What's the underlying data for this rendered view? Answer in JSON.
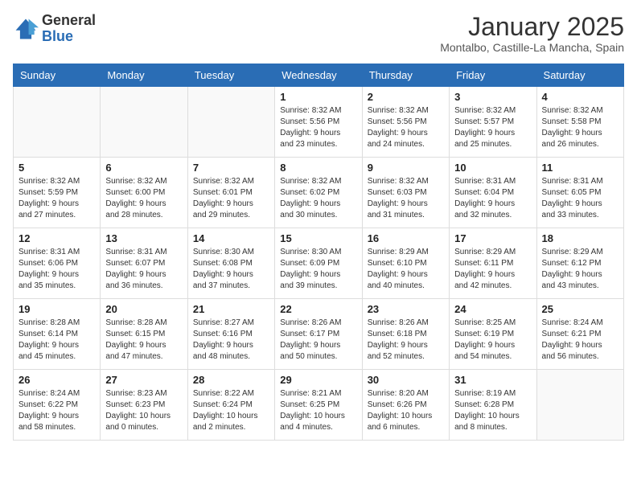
{
  "logo": {
    "general": "General",
    "blue": "Blue"
  },
  "title": "January 2025",
  "location": "Montalbo, Castille-La Mancha, Spain",
  "days_header": [
    "Sunday",
    "Monday",
    "Tuesday",
    "Wednesday",
    "Thursday",
    "Friday",
    "Saturday"
  ],
  "weeks": [
    [
      {
        "day": "",
        "info": ""
      },
      {
        "day": "",
        "info": ""
      },
      {
        "day": "",
        "info": ""
      },
      {
        "day": "1",
        "info": "Sunrise: 8:32 AM\nSunset: 5:56 PM\nDaylight: 9 hours\nand 23 minutes."
      },
      {
        "day": "2",
        "info": "Sunrise: 8:32 AM\nSunset: 5:56 PM\nDaylight: 9 hours\nand 24 minutes."
      },
      {
        "day": "3",
        "info": "Sunrise: 8:32 AM\nSunset: 5:57 PM\nDaylight: 9 hours\nand 25 minutes."
      },
      {
        "day": "4",
        "info": "Sunrise: 8:32 AM\nSunset: 5:58 PM\nDaylight: 9 hours\nand 26 minutes."
      }
    ],
    [
      {
        "day": "5",
        "info": "Sunrise: 8:32 AM\nSunset: 5:59 PM\nDaylight: 9 hours\nand 27 minutes."
      },
      {
        "day": "6",
        "info": "Sunrise: 8:32 AM\nSunset: 6:00 PM\nDaylight: 9 hours\nand 28 minutes."
      },
      {
        "day": "7",
        "info": "Sunrise: 8:32 AM\nSunset: 6:01 PM\nDaylight: 9 hours\nand 29 minutes."
      },
      {
        "day": "8",
        "info": "Sunrise: 8:32 AM\nSunset: 6:02 PM\nDaylight: 9 hours\nand 30 minutes."
      },
      {
        "day": "9",
        "info": "Sunrise: 8:32 AM\nSunset: 6:03 PM\nDaylight: 9 hours\nand 31 minutes."
      },
      {
        "day": "10",
        "info": "Sunrise: 8:31 AM\nSunset: 6:04 PM\nDaylight: 9 hours\nand 32 minutes."
      },
      {
        "day": "11",
        "info": "Sunrise: 8:31 AM\nSunset: 6:05 PM\nDaylight: 9 hours\nand 33 minutes."
      }
    ],
    [
      {
        "day": "12",
        "info": "Sunrise: 8:31 AM\nSunset: 6:06 PM\nDaylight: 9 hours\nand 35 minutes."
      },
      {
        "day": "13",
        "info": "Sunrise: 8:31 AM\nSunset: 6:07 PM\nDaylight: 9 hours\nand 36 minutes."
      },
      {
        "day": "14",
        "info": "Sunrise: 8:30 AM\nSunset: 6:08 PM\nDaylight: 9 hours\nand 37 minutes."
      },
      {
        "day": "15",
        "info": "Sunrise: 8:30 AM\nSunset: 6:09 PM\nDaylight: 9 hours\nand 39 minutes."
      },
      {
        "day": "16",
        "info": "Sunrise: 8:29 AM\nSunset: 6:10 PM\nDaylight: 9 hours\nand 40 minutes."
      },
      {
        "day": "17",
        "info": "Sunrise: 8:29 AM\nSunset: 6:11 PM\nDaylight: 9 hours\nand 42 minutes."
      },
      {
        "day": "18",
        "info": "Sunrise: 8:29 AM\nSunset: 6:12 PM\nDaylight: 9 hours\nand 43 minutes."
      }
    ],
    [
      {
        "day": "19",
        "info": "Sunrise: 8:28 AM\nSunset: 6:14 PM\nDaylight: 9 hours\nand 45 minutes."
      },
      {
        "day": "20",
        "info": "Sunrise: 8:28 AM\nSunset: 6:15 PM\nDaylight: 9 hours\nand 47 minutes."
      },
      {
        "day": "21",
        "info": "Sunrise: 8:27 AM\nSunset: 6:16 PM\nDaylight: 9 hours\nand 48 minutes."
      },
      {
        "day": "22",
        "info": "Sunrise: 8:26 AM\nSunset: 6:17 PM\nDaylight: 9 hours\nand 50 minutes."
      },
      {
        "day": "23",
        "info": "Sunrise: 8:26 AM\nSunset: 6:18 PM\nDaylight: 9 hours\nand 52 minutes."
      },
      {
        "day": "24",
        "info": "Sunrise: 8:25 AM\nSunset: 6:19 PM\nDaylight: 9 hours\nand 54 minutes."
      },
      {
        "day": "25",
        "info": "Sunrise: 8:24 AM\nSunset: 6:21 PM\nDaylight: 9 hours\nand 56 minutes."
      }
    ],
    [
      {
        "day": "26",
        "info": "Sunrise: 8:24 AM\nSunset: 6:22 PM\nDaylight: 9 hours\nand 58 minutes."
      },
      {
        "day": "27",
        "info": "Sunrise: 8:23 AM\nSunset: 6:23 PM\nDaylight: 10 hours\nand 0 minutes."
      },
      {
        "day": "28",
        "info": "Sunrise: 8:22 AM\nSunset: 6:24 PM\nDaylight: 10 hours\nand 2 minutes."
      },
      {
        "day": "29",
        "info": "Sunrise: 8:21 AM\nSunset: 6:25 PM\nDaylight: 10 hours\nand 4 minutes."
      },
      {
        "day": "30",
        "info": "Sunrise: 8:20 AM\nSunset: 6:26 PM\nDaylight: 10 hours\nand 6 minutes."
      },
      {
        "day": "31",
        "info": "Sunrise: 8:19 AM\nSunset: 6:28 PM\nDaylight: 10 hours\nand 8 minutes."
      },
      {
        "day": "",
        "info": ""
      }
    ]
  ]
}
